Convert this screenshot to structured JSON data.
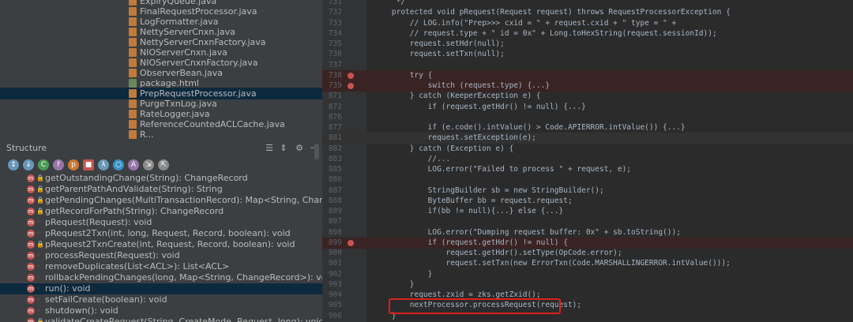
{
  "project_tree": {
    "files": [
      {
        "label": "ExpiryQueue.java",
        "color": "#c07a3b"
      },
      {
        "label": "FinalRequestProcessor.java",
        "color": "#c07a3b"
      },
      {
        "label": "LogFormatter.java",
        "color": "#c07a3b"
      },
      {
        "label": "NettyServerCnxn.java",
        "color": "#c07a3b"
      },
      {
        "label": "NettyServerCnxnFactory.java",
        "color": "#c07a3b"
      },
      {
        "label": "NIOServerCnxn.java",
        "color": "#c07a3b"
      },
      {
        "label": "NIOServerCnxnFactory.java",
        "color": "#c07a3b"
      },
      {
        "label": "ObserverBean.java",
        "color": "#c07a3b"
      },
      {
        "label": "package.html",
        "color": "#6a8759"
      },
      {
        "label": "PrepRequestProcessor.java",
        "color": "#c07a3b",
        "selected": true
      },
      {
        "label": "PurgeTxnLog.java",
        "color": "#c07a3b"
      },
      {
        "label": "RateLogger.java",
        "color": "#c07a3b"
      },
      {
        "label": "ReferenceCountedACLCache.java",
        "color": "#c07a3b"
      },
      {
        "label": "R...",
        "color": "#c07a3b"
      }
    ]
  },
  "structure": {
    "title": "Structure",
    "header_icons": [
      "collapse-icon",
      "expand-icon",
      "gear-icon",
      "hide-icon"
    ],
    "toolbar_icons": [
      {
        "name": "sort-visibility-icon",
        "color": "#6897bb",
        "glyph": "↕"
      },
      {
        "name": "sort-alpha-icon",
        "color": "#6897bb",
        "glyph": "↓"
      },
      {
        "name": "show-inherited-icon",
        "color": "#499c54",
        "glyph": "C"
      },
      {
        "name": "show-fields-icon",
        "color": "#9876aa",
        "glyph": "f"
      },
      {
        "name": "show-properties-icon",
        "color": "#cc7832",
        "glyph": "p"
      },
      {
        "name": "show-nonpublic-icon",
        "color": "#c75450",
        "glyph": "■"
      },
      {
        "name": "show-lambdas-icon",
        "color": "#6897bb",
        "glyph": "λ"
      },
      {
        "name": "show-anonymous-icon",
        "color": "#3592c4",
        "glyph": "○"
      },
      {
        "name": "show-interfaces-icon",
        "color": "#9876aa",
        "glyph": "A"
      },
      {
        "name": "autoscroll-to-source-icon",
        "color": "#8a8a8a",
        "glyph": "⇲"
      },
      {
        "name": "autoscroll-from-source-icon",
        "color": "#8a8a8a",
        "glyph": "⇱"
      }
    ],
    "members": [
      {
        "label": "getOutstandingChange(String): ChangeRecord",
        "vis": "🔒"
      },
      {
        "label": "getParentPathAndValidate(String): String",
        "vis": "🔒"
      },
      {
        "label": "getPendingChanges(MultiTransactionRecord): Map<String, ChangeRecord>",
        "vis": "🔒"
      },
      {
        "label": "getRecordForPath(String): ChangeRecord",
        "vis": "🔒"
      },
      {
        "label": "pRequest(Request): void",
        "vis": "◦"
      },
      {
        "label": "pRequest2Txn(int, long, Request, Record, boolean): void",
        "vis": "◦"
      },
      {
        "label": "pRequest2TxnCreate(int, Request, Record, boolean): void",
        "vis": "🔒"
      },
      {
        "label": "processRequest(Request): void",
        "vis": "◦"
      },
      {
        "label": "removeDuplicates(List<ACL>): List<ACL>",
        "vis": "◦"
      },
      {
        "label": "rollbackPendingChanges(long, Map<String, ChangeRecord>): void",
        "vis": "◦"
      },
      {
        "label": "run(): void",
        "vis": "◦",
        "selected": true
      },
      {
        "label": "setFailCreate(boolean): void",
        "vis": "◦"
      },
      {
        "label": "shutdown(): void",
        "vis": "◦"
      },
      {
        "label": "validateCreateRequest(String, CreateMode, Request, long): void",
        "vis": "🔒"
      }
    ]
  },
  "editor": {
    "lines": [
      {
        "num": "731",
        "text": "     */"
      },
      {
        "num": "732",
        "text": "    protected void pRequest(Request request) throws RequestProcessorException {"
      },
      {
        "num": "733",
        "text": "        // LOG.info(\"Prep>>> cxid = \" + request.cxid + \" type = \" +"
      },
      {
        "num": "734",
        "text": "        // request.type + \" id = 0x\" + Long.toHexString(request.sessionId));"
      },
      {
        "num": "735",
        "text": "        request.setHdr(null);"
      },
      {
        "num": "736",
        "text": "        request.setTxn(null);"
      },
      {
        "num": "737",
        "text": ""
      },
      {
        "num": "738",
        "text": "        try {",
        "bp": true
      },
      {
        "num": "739",
        "text": "            switch (request.type) {...}",
        "bp": true
      },
      {
        "num": "871",
        "text": "        } catch (KeeperException e) {"
      },
      {
        "num": "872",
        "text": "            if (request.getHdr() != null) {...}"
      },
      {
        "num": "876",
        "text": ""
      },
      {
        "num": "877",
        "text": "            if (e.code().intValue() > Code.APIERROR.intValue()) {...}"
      },
      {
        "num": "881",
        "text": "            request.setException(e);",
        "cur": true
      },
      {
        "num": "882",
        "text": "        } catch (Exception e) {"
      },
      {
        "num": "883",
        "text": "            //..."
      },
      {
        "num": "885",
        "text": "            LOG.error(\"Failed to process \" + request, e);"
      },
      {
        "num": "886",
        "text": ""
      },
      {
        "num": "887",
        "text": "            StringBuilder sb = new StringBuilder();"
      },
      {
        "num": "888",
        "text": "            ByteBuffer bb = request.request;"
      },
      {
        "num": "889",
        "text": "            if(bb != null){...} else {...}"
      },
      {
        "num": "897",
        "text": ""
      },
      {
        "num": "898",
        "text": "            LOG.error(\"Dumping request buffer: 0x\" + sb.toString());"
      },
      {
        "num": "899",
        "text": "            if (request.getHdr() != null) {",
        "bp": true
      },
      {
        "num": "900",
        "text": "                request.getHdr().setType(OpCode.error);"
      },
      {
        "num": "901",
        "text": "                request.setTxn(new ErrorTxn(Code.MARSHALLINGERROR.intValue()));"
      },
      {
        "num": "902",
        "text": "            }"
      },
      {
        "num": "903",
        "text": "        }"
      },
      {
        "num": "904",
        "text": "        request.zxid = zks.getZxid();"
      },
      {
        "num": "905",
        "text": "        nextProcessor.processRequest(request);"
      },
      {
        "num": "906",
        "text": "    }"
      }
    ]
  }
}
